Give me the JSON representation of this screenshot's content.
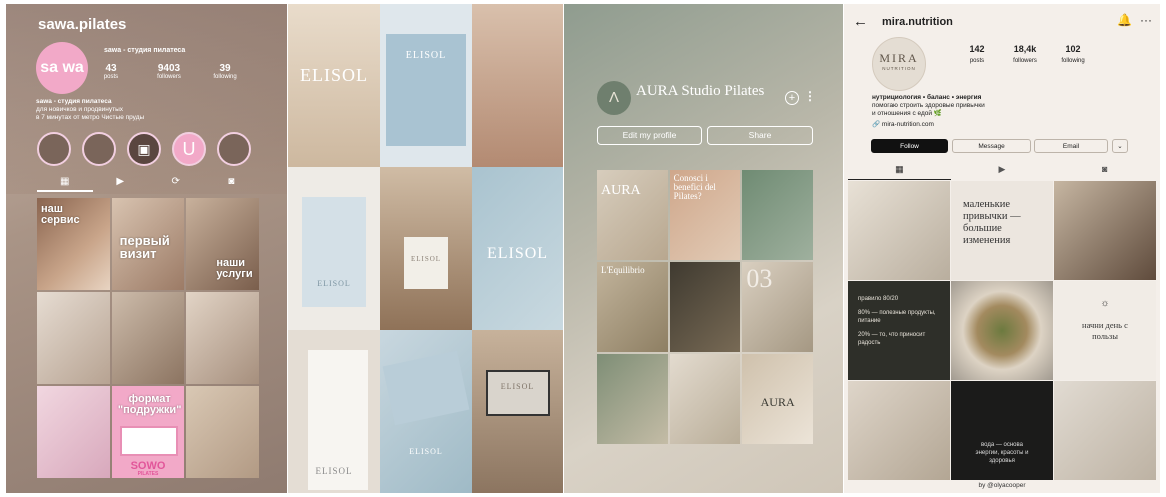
{
  "panel1": {
    "username": "sawa.pilates",
    "logo_text": "sa wa",
    "profile_name": "sawa - студия пилатеса",
    "stats": [
      {
        "value": "43",
        "label": "posts"
      },
      {
        "value": "9403",
        "label": "followers"
      },
      {
        "value": "39",
        "label": "following"
      }
    ],
    "bio_title": "sawa - студия пилатеса",
    "bio_line1": "для новичков и продвинутых",
    "bio_line2": "в 7 минутах от метро Чистые пруды",
    "highlight_u": "U",
    "posts": [
      {
        "text": "наш сервис"
      },
      {
        "text": "первый визит"
      },
      {
        "text": "наши услуги"
      },
      {
        "text": ""
      },
      {
        "text": ""
      },
      {
        "text": ""
      },
      {
        "text": ""
      },
      {
        "text": "формат \"подружки\""
      },
      {
        "text": ""
      }
    ],
    "post_footer": "SOWO",
    "post_footer_sub": "PILATES"
  },
  "panel2": {
    "brand": "ELISOL"
  },
  "panel3": {
    "logo_glyph": "Λ",
    "profile_name": "AURA Studio Pilates",
    "edit_button": "Edit my profile",
    "share_button": "Share",
    "posts": [
      {
        "text": "AURA"
      },
      {
        "text": "Conosci i benefici del Pilates?"
      },
      {
        "text": ""
      },
      {
        "text": "L'Equilibrio"
      },
      {
        "text": ""
      },
      {
        "text": "03"
      },
      {
        "text": ""
      },
      {
        "text": ""
      },
      {
        "text": "AURA"
      }
    ]
  },
  "panel4": {
    "username": "mira.nutrition",
    "logo_main": "MIRA",
    "logo_sub": "NUTRITION",
    "stats": [
      {
        "value": "142",
        "label": "posts"
      },
      {
        "value": "18,4k",
        "label": "followers"
      },
      {
        "value": "102",
        "label": "following"
      }
    ],
    "bio_title": "нутрициология • баланс • энергия",
    "bio_line1": "помогаю строить здоровые привычки",
    "bio_line2": "и отношения с едой 🌿",
    "link": "mira-nutrition.com",
    "follow_button": "Follow",
    "message_button": "Message",
    "email_button": "Email",
    "posts": {
      "habits": "маленькие привычки — большие изменения",
      "rule_title": "правило 80/20",
      "rule_line1": "80% — полезные продукты, питание",
      "rule_line2": "20% — то, что приносит радость",
      "start_title": "начни день с пользы",
      "water": "вода — основа энергии, красоты и здоровья"
    },
    "credit": "by @olyacooper"
  },
  "icons": {
    "grid": "▦",
    "reels": "▶",
    "repost": "⟳",
    "tagged": "◙",
    "back": "←",
    "bell": "🔔",
    "more": "···",
    "chevron": "⌄",
    "plus": "+",
    "dots": "⋮",
    "link": "🔗"
  }
}
